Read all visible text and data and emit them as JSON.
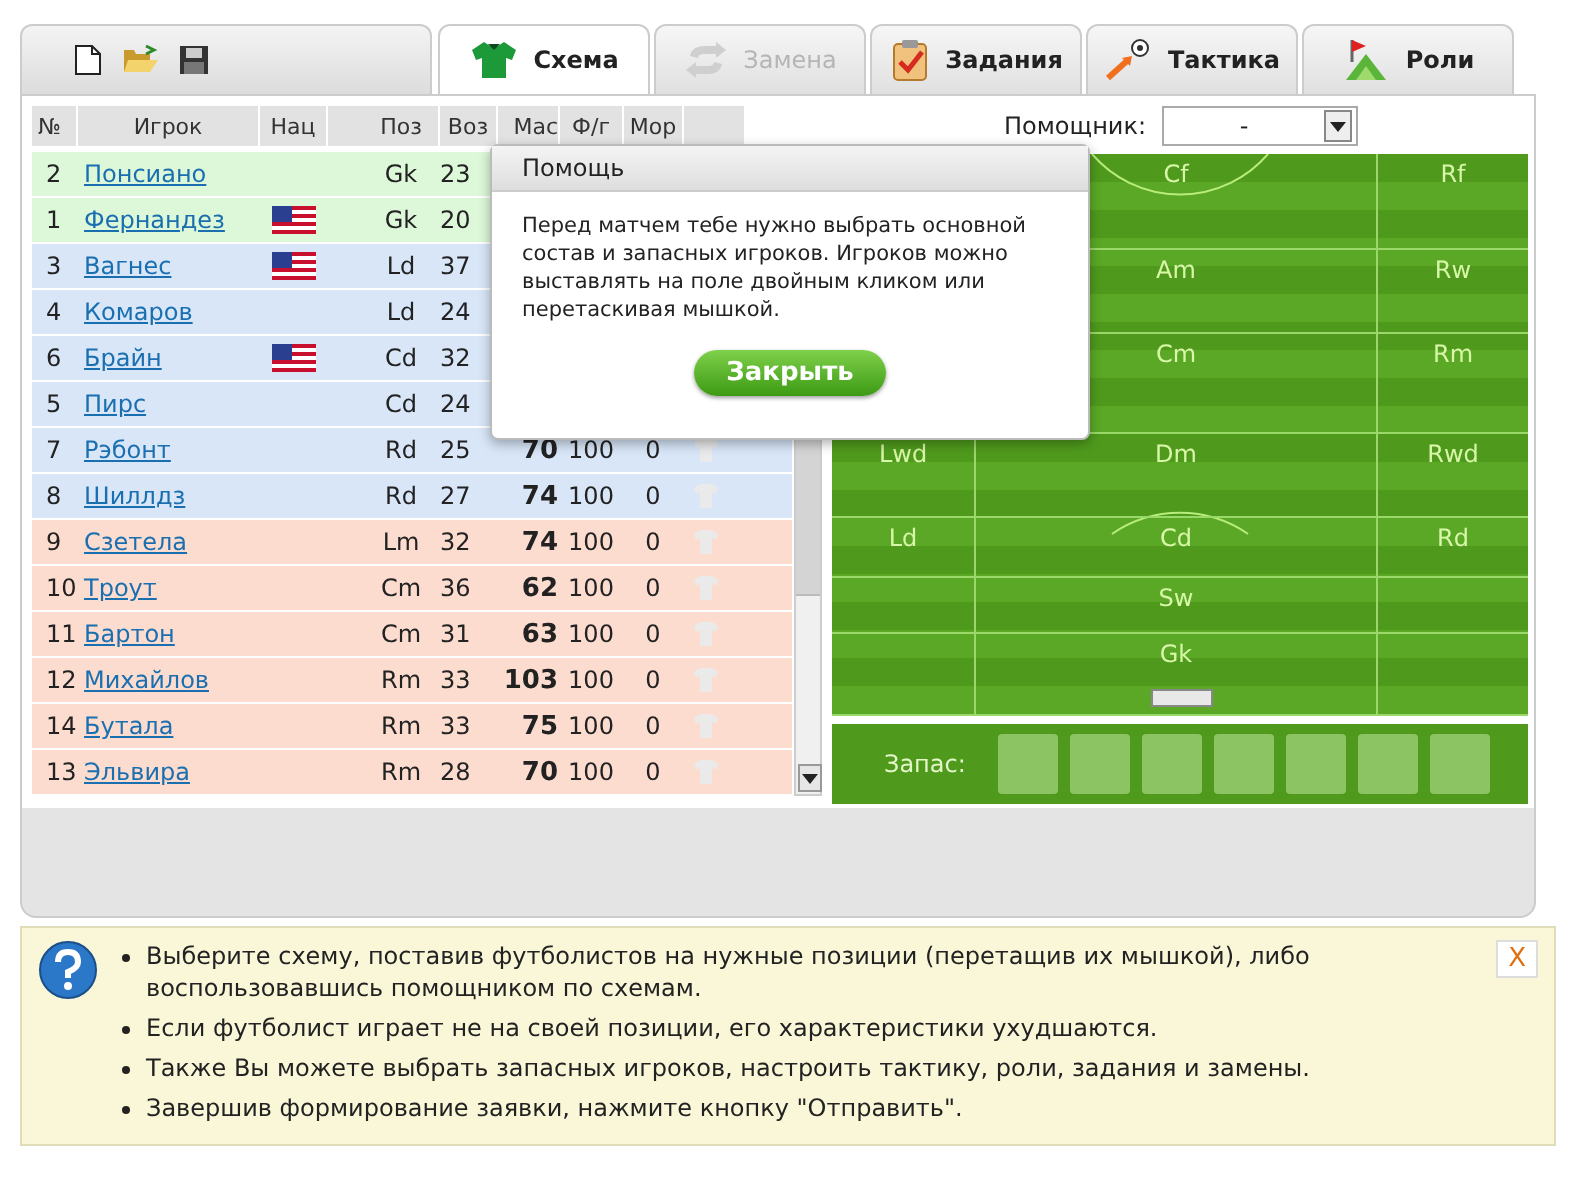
{
  "tabs": [
    {
      "label": "Схема",
      "kind": "shirt",
      "selected": true,
      "disabled": false
    },
    {
      "label": "Замена",
      "kind": "swap",
      "selected": false,
      "disabled": true
    },
    {
      "label": "Задания",
      "kind": "clipboard",
      "selected": false,
      "disabled": false
    },
    {
      "label": "Тактика",
      "kind": "ball",
      "selected": false,
      "disabled": false
    },
    {
      "label": "Роли",
      "kind": "flag",
      "selected": false,
      "disabled": false
    }
  ],
  "table": {
    "columns": [
      "№",
      "Игрок",
      "Нац",
      "Поз",
      "Воз",
      "Мас",
      "Ф/г",
      "Мор"
    ],
    "rows": [
      {
        "num": "2",
        "name": "Понсиано",
        "flag": false,
        "pos": "Gk",
        "age": "23",
        "kind": "gk"
      },
      {
        "num": "1",
        "name": "Фернандез",
        "flag": true,
        "pos": "Gk",
        "age": "20",
        "kind": "gk"
      },
      {
        "num": "3",
        "name": "Вагнес",
        "flag": true,
        "pos": "Ld",
        "age": "37",
        "kind": "def"
      },
      {
        "num": "4",
        "name": "Комаров",
        "flag": false,
        "pos": "Ld",
        "age": "24",
        "kind": "def"
      },
      {
        "num": "6",
        "name": "Брайн",
        "flag": true,
        "pos": "Cd",
        "age": "32",
        "kind": "def"
      },
      {
        "num": "5",
        "name": "Пирс",
        "flag": false,
        "pos": "Cd",
        "age": "24",
        "kind": "def"
      },
      {
        "num": "7",
        "name": "Рэбонт",
        "flag": false,
        "pos": "Rd",
        "age": "25",
        "mas": "70",
        "fg": "100",
        "mor": "0",
        "kind": "def"
      },
      {
        "num": "8",
        "name": "Шиллдз",
        "flag": false,
        "pos": "Rd",
        "age": "27",
        "mas": "74",
        "fg": "100",
        "mor": "0",
        "kind": "def"
      },
      {
        "num": "9",
        "name": "Сзетела",
        "flag": false,
        "pos": "Lm",
        "age": "32",
        "mas": "74",
        "fg": "100",
        "mor": "0",
        "kind": "mid"
      },
      {
        "num": "10",
        "name": "Троут",
        "flag": false,
        "pos": "Cm",
        "age": "36",
        "mas": "62",
        "fg": "100",
        "mor": "0",
        "kind": "mid"
      },
      {
        "num": "11",
        "name": "Бартон",
        "flag": false,
        "pos": "Cm",
        "age": "31",
        "mas": "63",
        "fg": "100",
        "mor": "0",
        "kind": "mid"
      },
      {
        "num": "12",
        "name": "Михайлов",
        "flag": false,
        "pos": "Rm",
        "age": "33",
        "mas": "103",
        "fg": "100",
        "mor": "0",
        "kind": "mid"
      },
      {
        "num": "14",
        "name": "Бутала",
        "flag": false,
        "pos": "Rm",
        "age": "33",
        "mas": "75",
        "fg": "100",
        "mor": "0",
        "kind": "mid"
      },
      {
        "num": "13",
        "name": "Эльвира",
        "flag": false,
        "pos": "Rm",
        "age": "28",
        "mas": "70",
        "fg": "100",
        "mor": "0",
        "kind": "mid"
      }
    ]
  },
  "helper": {
    "label": "Помощник:",
    "value": "-"
  },
  "pitch": {
    "rows": [
      {
        "center": "Cf",
        "right": "Rf"
      },
      {
        "center": "Am",
        "right": "Rw"
      },
      {
        "center": "Cm",
        "right": "Rm"
      },
      {
        "left": "Lwd",
        "center": "Dm",
        "right": "Rwd"
      },
      {
        "left": "Ld",
        "center": "Cd",
        "right": "Rd"
      },
      {
        "center": "Sw"
      },
      {
        "center": "Gk"
      }
    ]
  },
  "reserve": {
    "label": "Запас:"
  },
  "dialog": {
    "title": "Помощь",
    "text": "Перед матчем тебе нужно выбрать основной состав и запасных игроков. Игроков можно выставлять на поле двойным кликом или перетаскивая мышкой.",
    "button": "Закрыть"
  },
  "help": {
    "items": [
      "Выберите схему, поставив футболистов на нужные позиции (перетащив их мышкой), либо воспользовавшись помощником по схемам.",
      "Если футболист играет не на своей позиции, его характеристики ухудшаются.",
      "Также Вы можете выбрать запасных игроков, настроить тактику, роли, задания и замены.",
      "Завершив формирование заявки, нажмите кнопку \"Отправить\"."
    ],
    "close": "X"
  }
}
